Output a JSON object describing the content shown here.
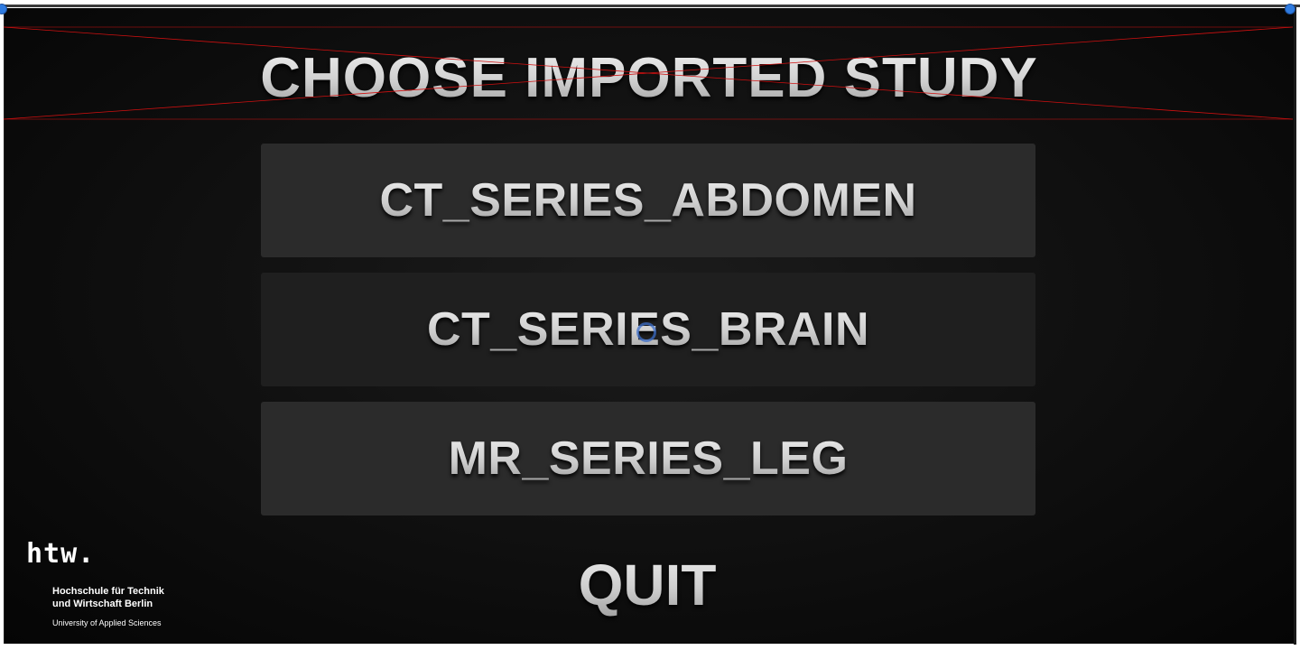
{
  "screen": {
    "title": "CHOOSE IMPORTED STUDY"
  },
  "studies": [
    {
      "label": "CT_SERIES_ABDOMEN"
    },
    {
      "label": "CT_SERIES_BRAIN"
    },
    {
      "label": "MR_SERIES_LEG"
    }
  ],
  "quit_label": "QUIT",
  "logo": {
    "mark": "htw.",
    "line1": "Hochschule für Technik",
    "line2": "und Wirtschaft Berlin",
    "line3": "University of Applied Sciences"
  },
  "colors": {
    "background": "#0b0b0b",
    "button": "#2b2b2b",
    "button_hover": "#1f1f1f",
    "text": "#d6d6d6",
    "selection_handle": "#2f7be0",
    "guide_line": "#d01010"
  },
  "icons": {
    "cursor": "ring-cursor-icon",
    "selection_handles": "resize-handle-icon"
  }
}
